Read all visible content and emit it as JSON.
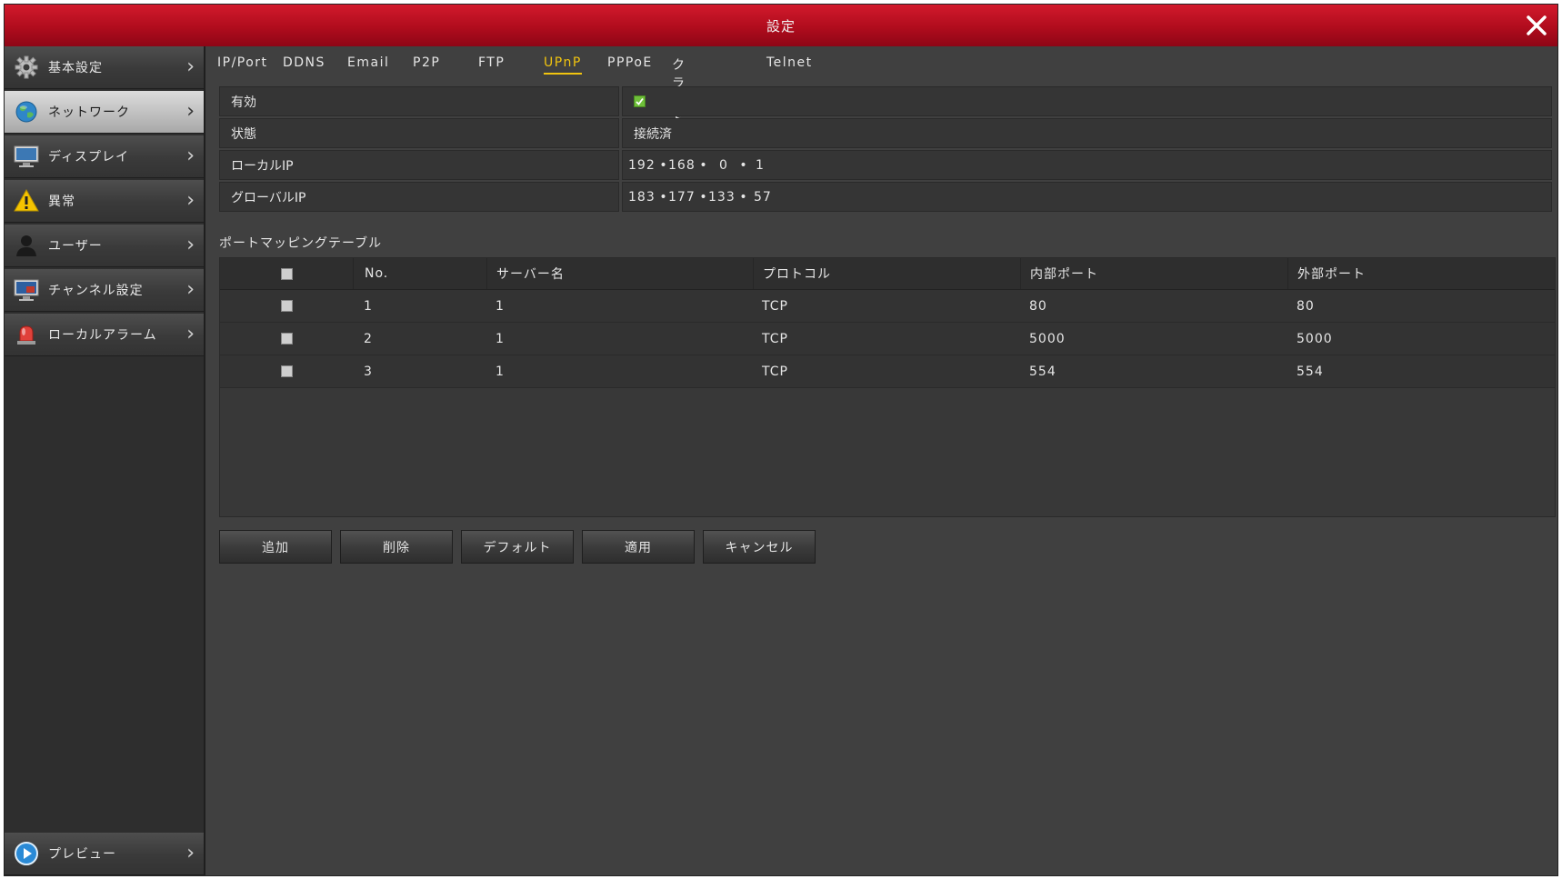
{
  "window": {
    "title": "設定",
    "accent": "#b00c1d",
    "close_icon": "close-icon"
  },
  "sidebar": {
    "items": [
      {
        "label": "基本設定",
        "icon": "gear-icon"
      },
      {
        "label": "ネットワーク",
        "icon": "globe-icon",
        "active": true
      },
      {
        "label": "ディスプレイ",
        "icon": "monitor-icon"
      },
      {
        "label": "異常",
        "icon": "warning-icon"
      },
      {
        "label": "ユーザー",
        "icon": "user-icon"
      },
      {
        "label": "チャンネル設定",
        "icon": "channel-icon"
      },
      {
        "label": "ローカルアラーム",
        "icon": "alarm-icon"
      }
    ],
    "bottom": {
      "label": "プレビュー",
      "icon": "play-icon"
    }
  },
  "tabs": [
    "IP/Port",
    "DDNS",
    "Email",
    "P2P",
    "FTP",
    "UPnP",
    "PPPoE",
    "クラウド",
    "Telnet"
  ],
  "active_tab": "UPnP",
  "form": {
    "enabled_label": "有効",
    "enabled": true,
    "status_label": "状態",
    "status_value": "接続済",
    "local_ip_label": "ローカルIP",
    "local_ip": [
      "192",
      "168",
      "0",
      "1"
    ],
    "global_ip_label": "グローバルIP",
    "global_ip": [
      "183",
      "177",
      "133",
      "57"
    ]
  },
  "mapping": {
    "title": "ポートマッピングテーブル",
    "headers": [
      "No.",
      "サーバー名",
      "プロトコル",
      "内部ポート",
      "外部ポート"
    ],
    "rows": [
      {
        "no": "1",
        "server": "1",
        "protocol": "TCP",
        "internal": "80",
        "external": "80"
      },
      {
        "no": "2",
        "server": "1",
        "protocol": "TCP",
        "internal": "5000",
        "external": "5000"
      },
      {
        "no": "3",
        "server": "1",
        "protocol": "TCP",
        "internal": "554",
        "external": "554"
      }
    ]
  },
  "buttons": {
    "add": "追加",
    "delete": "削除",
    "default": "デフォルト",
    "apply": "適用",
    "cancel": "キャンセル"
  },
  "tab_active_color": "#f1c40f"
}
